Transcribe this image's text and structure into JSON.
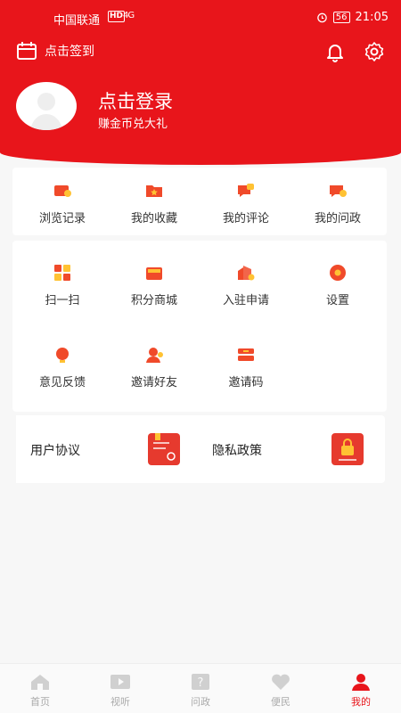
{
  "status": {
    "carrier": "中国联通",
    "hd": "HD",
    "signal": "4G",
    "battery": "56",
    "time": "21:05"
  },
  "header": {
    "signin_label": "点击签到",
    "login_title": "点击登录",
    "login_sub": "赚金币兑大礼"
  },
  "row1": [
    {
      "label": "浏览记录",
      "icon": "history-icon"
    },
    {
      "label": "我的收藏",
      "icon": "favorite-icon"
    },
    {
      "label": "我的评论",
      "icon": "comment-icon"
    },
    {
      "label": "我的问政",
      "icon": "inquiry-icon"
    }
  ],
  "grid": [
    {
      "label": "扫一扫",
      "icon": "scan-icon"
    },
    {
      "label": "积分商城",
      "icon": "points-mall-icon"
    },
    {
      "label": "入驻申请",
      "icon": "apply-icon"
    },
    {
      "label": "设置",
      "icon": "settings-icon"
    },
    {
      "label": "意见反馈",
      "icon": "feedback-icon"
    },
    {
      "label": "邀请好友",
      "icon": "invite-friend-icon"
    },
    {
      "label": "邀请码",
      "icon": "invite-code-icon"
    }
  ],
  "bottom_cards": {
    "left": "用户协议",
    "right": "隐私政策"
  },
  "tabs": [
    {
      "label": "首页"
    },
    {
      "label": "视听"
    },
    {
      "label": "问政"
    },
    {
      "label": "便民"
    },
    {
      "label": "我的"
    }
  ],
  "colors": {
    "brand": "#e8151b",
    "icon": "#f04a2a",
    "icon_accent": "#ffc233",
    "tab_inactive": "#cccccc"
  }
}
